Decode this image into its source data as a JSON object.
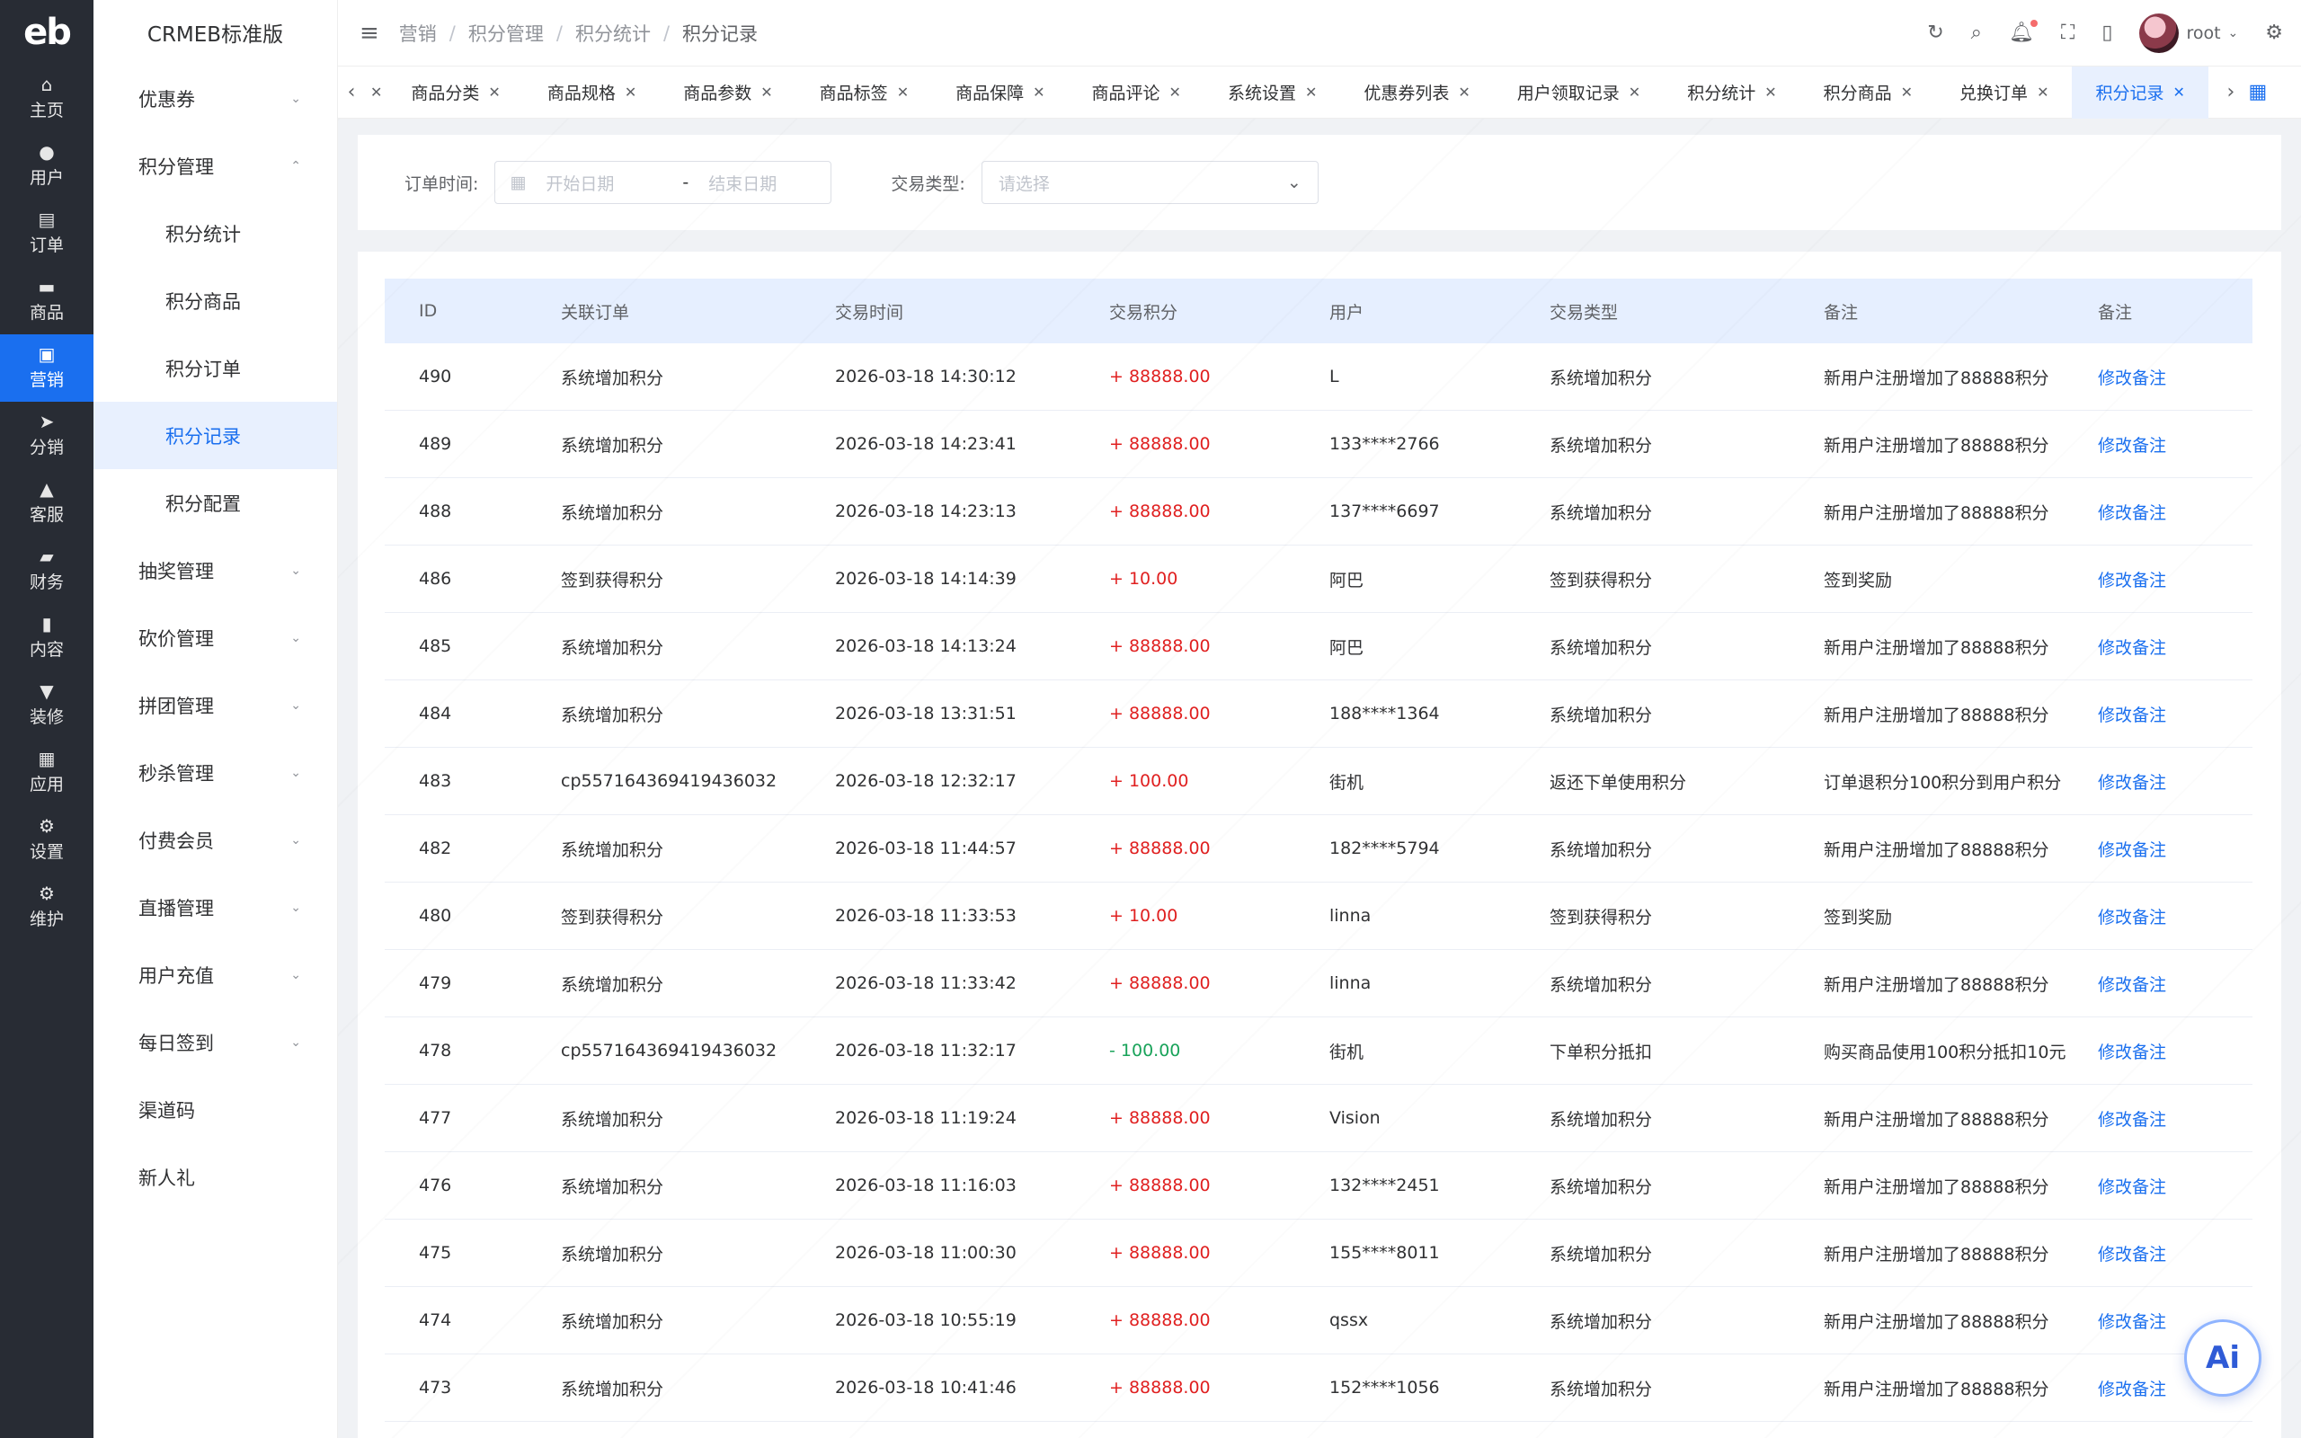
{
  "rail": {
    "logo": "eb",
    "items": [
      {
        "label": "主页",
        "icon": "home-icon",
        "glyph": "⌂"
      },
      {
        "label": "用户",
        "icon": "user-icon",
        "glyph": "●"
      },
      {
        "label": "订单",
        "icon": "order-icon",
        "glyph": "▤"
      },
      {
        "label": "商品",
        "icon": "product-icon",
        "glyph": "▬"
      },
      {
        "label": "营销",
        "icon": "marketing-icon",
        "glyph": "▣"
      },
      {
        "label": "分销",
        "icon": "distribution-icon",
        "glyph": "➤"
      },
      {
        "label": "客服",
        "icon": "service-icon",
        "glyph": "▲"
      },
      {
        "label": "财务",
        "icon": "finance-icon",
        "glyph": "▰"
      },
      {
        "label": "内容",
        "icon": "content-icon",
        "glyph": "▮"
      },
      {
        "label": "装修",
        "icon": "decorate-icon",
        "glyph": "▼"
      },
      {
        "label": "应用",
        "icon": "apps-icon",
        "glyph": "▦"
      },
      {
        "label": "设置",
        "icon": "settings-icon",
        "glyph": "⚙"
      },
      {
        "label": "维护",
        "icon": "maintain-icon",
        "glyph": "⚙"
      }
    ]
  },
  "sidebar": {
    "title": "CRMEB标准版",
    "items": [
      {
        "label": "优惠券",
        "chev": "⌄"
      },
      {
        "label": "积分管理",
        "chev": "⌃"
      },
      {
        "label": "积分统计"
      },
      {
        "label": "积分商品"
      },
      {
        "label": "积分订单"
      },
      {
        "label": "积分记录"
      },
      {
        "label": "积分配置"
      },
      {
        "label": "抽奖管理",
        "chev": "⌄"
      },
      {
        "label": "砍价管理",
        "chev": "⌄"
      },
      {
        "label": "拼团管理",
        "chev": "⌄"
      },
      {
        "label": "秒杀管理",
        "chev": "⌄"
      },
      {
        "label": "付费会员",
        "chev": "⌄"
      },
      {
        "label": "直播管理",
        "chev": "⌄"
      },
      {
        "label": "用户充值",
        "chev": "⌄"
      },
      {
        "label": "每日签到",
        "chev": "⌄"
      },
      {
        "label": "渠道码"
      },
      {
        "label": "新人礼"
      }
    ]
  },
  "header": {
    "breadcrumb": [
      "营销",
      "积分管理",
      "积分统计",
      "积分记录"
    ],
    "separator": "/",
    "username": "root"
  },
  "tabs": [
    "商品分类",
    "商品规格",
    "商品参数",
    "商品标签",
    "商品保障",
    "商品评论",
    "系统设置",
    "优惠券列表",
    "用户领取记录",
    "积分统计",
    "积分商品",
    "兑换订单",
    "积分记录"
  ],
  "filter": {
    "order_time_label": "订单时间:",
    "start_placeholder": "开始日期",
    "range_sep": "-",
    "end_placeholder": "结束日期",
    "type_label": "交易类型:",
    "type_placeholder": "请选择"
  },
  "table": {
    "headers": [
      "ID",
      "关联订单",
      "交易时间",
      "交易积分",
      "用户",
      "交易类型",
      "备注",
      "备注"
    ],
    "rows": [
      {
        "id": "490",
        "order": "系统增加积分",
        "time": "2026-03-18 14:30:12",
        "points": "+ 88888.00",
        "sign": "plus",
        "user": "L",
        "type": "系统增加积分",
        "remark": "新用户注册增加了88888积分",
        "action": "修改备注"
      },
      {
        "id": "489",
        "order": "系统增加积分",
        "time": "2026-03-18 14:23:41",
        "points": "+ 88888.00",
        "sign": "plus",
        "user": "133****2766",
        "type": "系统增加积分",
        "remark": "新用户注册增加了88888积分",
        "action": "修改备注"
      },
      {
        "id": "488",
        "order": "系统增加积分",
        "time": "2026-03-18 14:23:13",
        "points": "+ 88888.00",
        "sign": "plus",
        "user": "137****6697",
        "type": "系统增加积分",
        "remark": "新用户注册增加了88888积分",
        "action": "修改备注"
      },
      {
        "id": "486",
        "order": "签到获得积分",
        "time": "2026-03-18 14:14:39",
        "points": "+ 10.00",
        "sign": "plus",
        "user": "阿巴",
        "type": "签到获得积分",
        "remark": "签到奖励",
        "action": "修改备注"
      },
      {
        "id": "485",
        "order": "系统增加积分",
        "time": "2026-03-18 14:13:24",
        "points": "+ 88888.00",
        "sign": "plus",
        "user": "阿巴",
        "type": "系统增加积分",
        "remark": "新用户注册增加了88888积分",
        "action": "修改备注"
      },
      {
        "id": "484",
        "order": "系统增加积分",
        "time": "2026-03-18 13:31:51",
        "points": "+ 88888.00",
        "sign": "plus",
        "user": "188****1364",
        "type": "系统增加积分",
        "remark": "新用户注册增加了88888积分",
        "action": "修改备注"
      },
      {
        "id": "483",
        "order": "cp557164369419436032",
        "time": "2026-03-18 12:32:17",
        "points": "+ 100.00",
        "sign": "plus",
        "user": "街机",
        "type": "返还下单使用积分",
        "remark": "订单退积分100积分到用户积分",
        "action": "修改备注"
      },
      {
        "id": "482",
        "order": "系统增加积分",
        "time": "2026-03-18 11:44:57",
        "points": "+ 88888.00",
        "sign": "plus",
        "user": "182****5794",
        "type": "系统增加积分",
        "remark": "新用户注册增加了88888积分",
        "action": "修改备注"
      },
      {
        "id": "480",
        "order": "签到获得积分",
        "time": "2026-03-18 11:33:53",
        "points": "+ 10.00",
        "sign": "plus",
        "user": "linna",
        "type": "签到获得积分",
        "remark": "签到奖励",
        "action": "修改备注"
      },
      {
        "id": "479",
        "order": "系统增加积分",
        "time": "2026-03-18 11:33:42",
        "points": "+ 88888.00",
        "sign": "plus",
        "user": "linna",
        "type": "系统增加积分",
        "remark": "新用户注册增加了88888积分",
        "action": "修改备注"
      },
      {
        "id": "478",
        "order": "cp557164369419436032",
        "time": "2026-03-18 11:32:17",
        "points": "- 100.00",
        "sign": "minus",
        "user": "街机",
        "type": "下单积分抵扣",
        "remark": "购买商品使用100积分抵扣10元",
        "action": "修改备注"
      },
      {
        "id": "477",
        "order": "系统增加积分",
        "time": "2026-03-18 11:19:24",
        "points": "+ 88888.00",
        "sign": "plus",
        "user": "Vision",
        "type": "系统增加积分",
        "remark": "新用户注册增加了88888积分",
        "action": "修改备注"
      },
      {
        "id": "476",
        "order": "系统增加积分",
        "time": "2026-03-18 11:16:03",
        "points": "+ 88888.00",
        "sign": "plus",
        "user": "132****2451",
        "type": "系统增加积分",
        "remark": "新用户注册增加了88888积分",
        "action": "修改备注"
      },
      {
        "id": "475",
        "order": "系统增加积分",
        "time": "2026-03-18 11:00:30",
        "points": "+ 88888.00",
        "sign": "plus",
        "user": "155****8011",
        "type": "系统增加积分",
        "remark": "新用户注册增加了88888积分",
        "action": "修改备注"
      },
      {
        "id": "474",
        "order": "系统增加积分",
        "time": "2026-03-18 10:55:19",
        "points": "+ 88888.00",
        "sign": "plus",
        "user": "qssx",
        "type": "系统增加积分",
        "remark": "新用户注册增加了88888积分",
        "action": "修改备注"
      },
      {
        "id": "473",
        "order": "系统增加积分",
        "time": "2026-03-18 10:41:46",
        "points": "+ 88888.00",
        "sign": "plus",
        "user": "152****1056",
        "type": "系统增加积分",
        "remark": "新用户注册增加了88888积分",
        "action": "修改备注"
      }
    ]
  },
  "ai_button": "Ai",
  "colors": {
    "accent": "#1a6fef",
    "rail_bg": "#282c34",
    "plus": "#e02020",
    "minus": "#19a35a"
  }
}
